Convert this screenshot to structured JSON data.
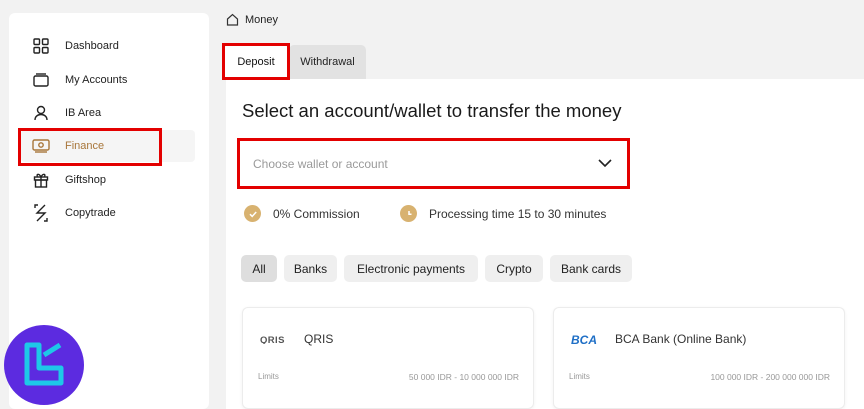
{
  "sidebar": {
    "items": [
      {
        "label": "Dashboard",
        "icon": "grid-icon"
      },
      {
        "label": "My Accounts",
        "icon": "wallet-icon"
      },
      {
        "label": "IB Area",
        "icon": "user-icon"
      },
      {
        "label": "Finance",
        "icon": "money-icon"
      },
      {
        "label": "Giftshop",
        "icon": "gift-icon"
      },
      {
        "label": "Copytrade",
        "icon": "copytrade-icon"
      }
    ]
  },
  "breadcrumb": {
    "label": "Money"
  },
  "tabs": {
    "deposit": "Deposit",
    "withdrawal": "Withdrawal"
  },
  "main": {
    "title": "Select an account/wallet to transfer the money",
    "select_placeholder": "Choose wallet or account",
    "info": {
      "commission": "0% Commission",
      "processing": "Processing time 15 to 30 minutes"
    }
  },
  "filters": [
    "All",
    "Banks",
    "Electronic payments",
    "Crypto",
    "Bank cards"
  ],
  "cards": [
    {
      "logo": "QRIS",
      "name": "QRIS",
      "limits_label": "Limits",
      "limits": "50 000 IDR - 10 000 000 IDR"
    },
    {
      "logo": "BCA",
      "name": "BCA Bank (Online Bank)",
      "limits_label": "Limits",
      "limits": "100 000 IDR - 200 000 000 IDR"
    }
  ],
  "colors": {
    "accent": "#a8763a",
    "highlight": "#e30000",
    "badge": "#d8b270",
    "brand": "#5c2be0"
  }
}
